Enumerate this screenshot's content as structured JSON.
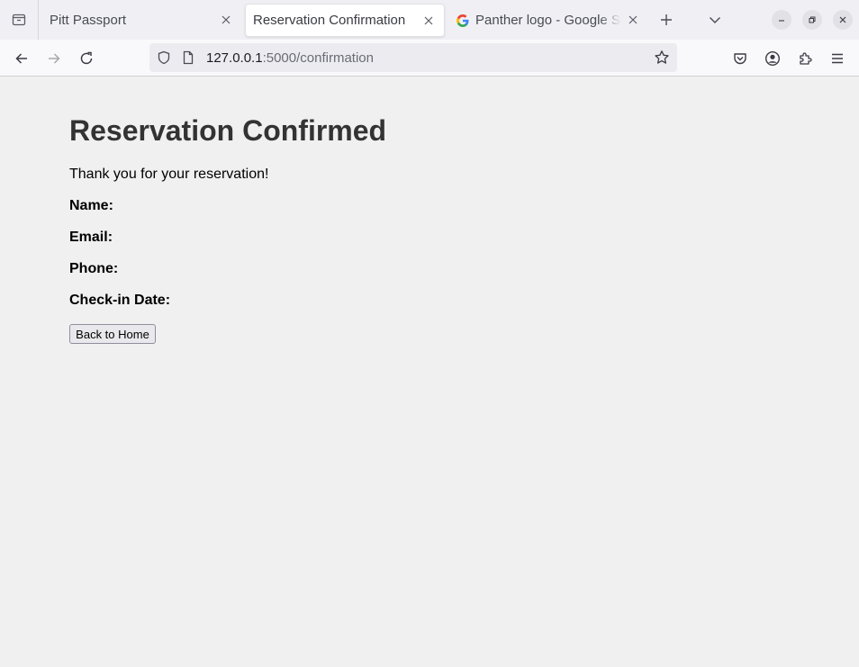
{
  "browser": {
    "tabs": [
      {
        "title": "Pitt Passport",
        "active": false
      },
      {
        "title": "Reservation Confirmation",
        "active": true
      },
      {
        "title": "Panther logo - Google Search",
        "active": false,
        "favicon": "google-icon"
      }
    ],
    "url": {
      "host": "127.0.0.1",
      "path": ":5000/confirmation"
    }
  },
  "page": {
    "heading": "Reservation Confirmed",
    "message": "Thank you for your reservation!",
    "fields": {
      "name_label": "Name:",
      "email_label": "Email:",
      "phone_label": "Phone:",
      "checkin_label": "Check-in Date:"
    },
    "back_button_label": "Back to Home"
  },
  "colors": {
    "page_background": "#f0f0f0",
    "heading": "#333333",
    "tab_strip": "#f0f0f4",
    "active_tab": "#ffffff"
  }
}
